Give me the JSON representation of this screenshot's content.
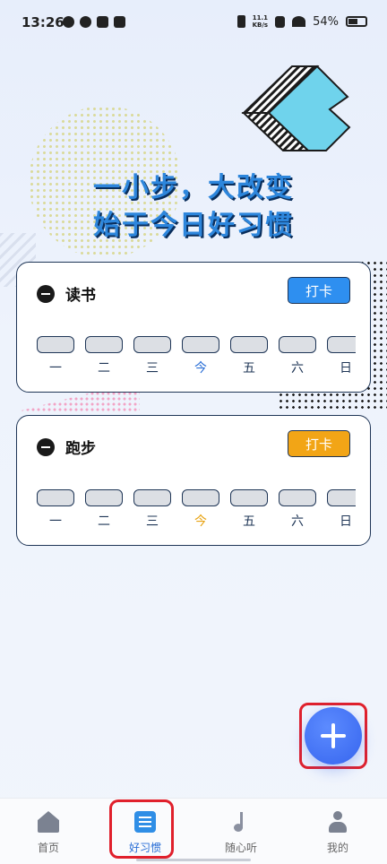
{
  "status_bar": {
    "time": "13:26",
    "net_speed_value": "11.1",
    "net_speed_unit": "KB/s",
    "battery": "54%"
  },
  "slogan": {
    "line1": "一小步，大改变",
    "line2": "始于今日好习惯"
  },
  "habits": [
    {
      "name": "读书",
      "checkin_label": "打卡",
      "checkin_color": "#2e8ff0",
      "today_color": "#2b6fd6",
      "days": [
        "一",
        "二",
        "三",
        "今",
        "五",
        "六",
        "日"
      ]
    },
    {
      "name": "跑步",
      "checkin_label": "打卡",
      "checkin_color": "#f2a516",
      "today_color": "#e8a312",
      "days": [
        "一",
        "二",
        "三",
        "今",
        "五",
        "六",
        "日"
      ]
    }
  ],
  "bottom_nav": [
    {
      "label": "首页",
      "icon": "home-icon"
    },
    {
      "label": "好习惯",
      "icon": "habit-checklist-icon"
    },
    {
      "label": "随心听",
      "icon": "music-note-icon"
    },
    {
      "label": "我的",
      "icon": "user-icon"
    }
  ],
  "colors": {
    "accent": "#2b6fd6",
    "highlight": "#e0202c",
    "fab": "#3665ee"
  }
}
